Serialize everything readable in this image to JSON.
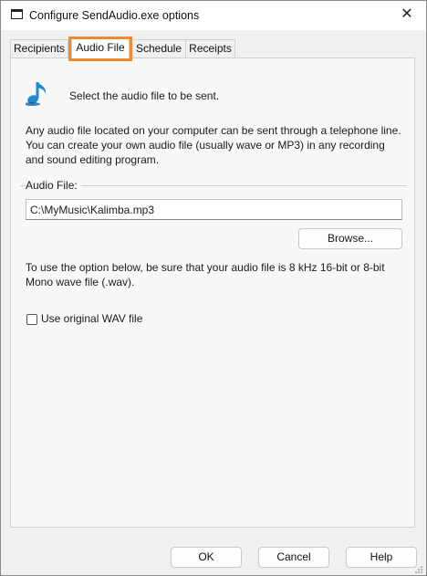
{
  "window": {
    "title": "Configure SendAudio.exe options",
    "close_glyph": "✕"
  },
  "tabs": [
    {
      "label": "Recipients",
      "active": false
    },
    {
      "label": "Audio File",
      "active": true
    },
    {
      "label": "Schedule",
      "active": false
    },
    {
      "label": "Receipts",
      "active": false
    }
  ],
  "audio_panel": {
    "icon": "music-note-icon",
    "headline": "Select the audio file to be sent.",
    "description": "Any audio file located on your computer can be sent through a telephone line. You can create your own audio file (usually wave or MP3) in any recording and sound editing program.",
    "group_label": "Audio File:",
    "file_path": "C:\\MyMusic\\Kalimba.mp3",
    "browse_label": "Browse...",
    "note": "To use the option below, be sure that your audio file is 8 kHz 16-bit or 8-bit Mono wave file (.wav).",
    "checkbox_label": "Use original WAV file",
    "checkbox_checked": false
  },
  "buttons": {
    "ok": "OK",
    "cancel": "Cancel",
    "help": "Help"
  },
  "colors": {
    "highlight": "#f08a2c",
    "icon_blue": "#1f8ad2"
  }
}
